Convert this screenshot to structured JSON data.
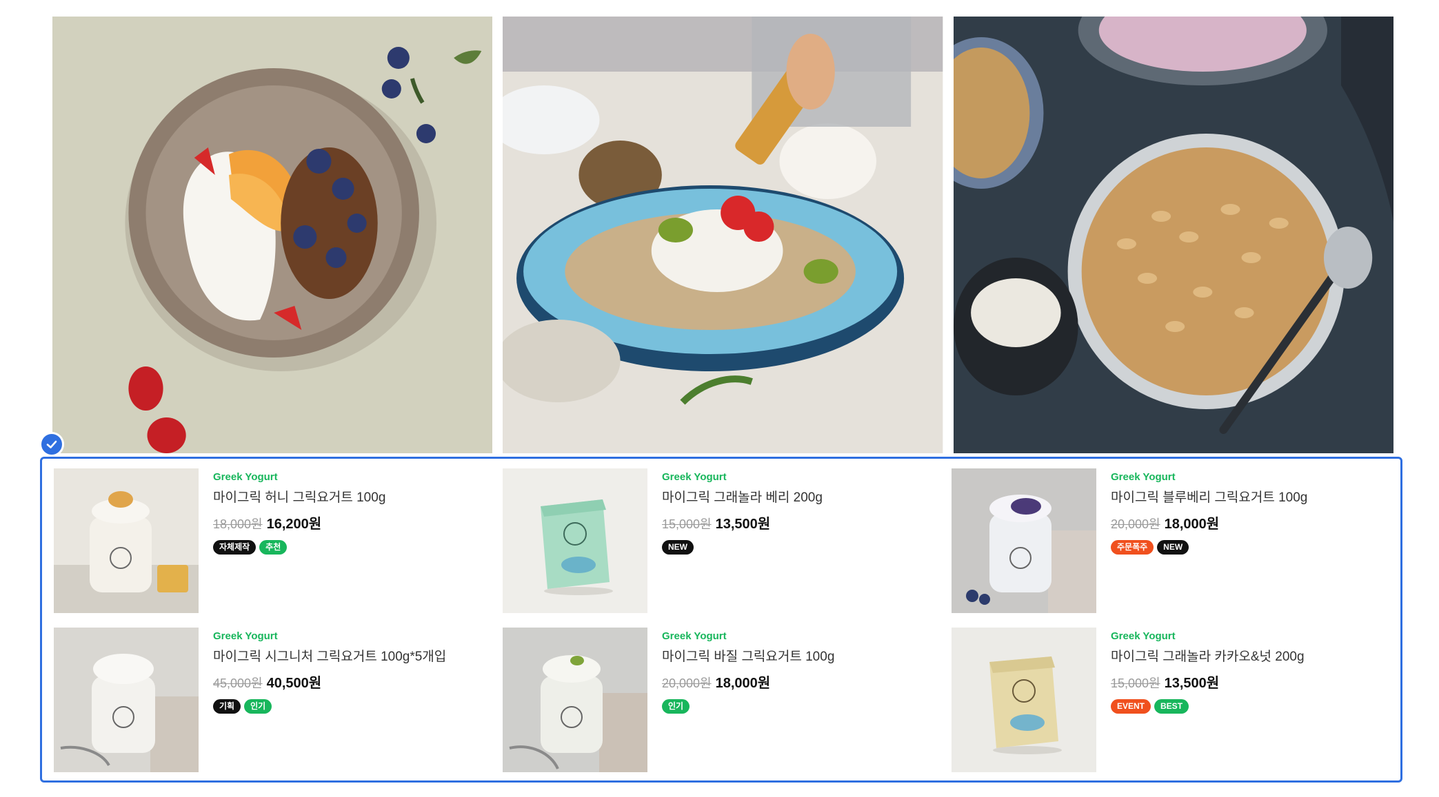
{
  "hero": {
    "photos": [
      {
        "icon": "yogurt-bowl-photo"
      },
      {
        "icon": "granola-honey-bowl-photo"
      },
      {
        "icon": "oat-granola-bowl-photo"
      }
    ]
  },
  "products": [
    {
      "category": "Greek Yogurt",
      "name": "마이그릭 허니 그릭요거트 100g",
      "old_price": "18,000원",
      "price": "16,200원",
      "badges": [
        {
          "label": "자체제작",
          "color": "black"
        },
        {
          "label": "추천",
          "color": "green"
        }
      ]
    },
    {
      "category": "Greek Yogurt",
      "name": "마이그릭 그래놀라 베리 200g",
      "old_price": "15,000원",
      "price": "13,500원",
      "badges": [
        {
          "label": "NEW",
          "color": "black"
        }
      ]
    },
    {
      "category": "Greek Yogurt",
      "name": "마이그릭 블루베리 그릭요거트 100g",
      "old_price": "20,000원",
      "price": "18,000원",
      "badges": [
        {
          "label": "주문폭주",
          "color": "orange"
        },
        {
          "label": "NEW",
          "color": "black"
        }
      ]
    },
    {
      "category": "Greek Yogurt",
      "name": "마이그릭 시그니처 그릭요거트 100g*5개입",
      "old_price": "45,000원",
      "price": "40,500원",
      "badges": [
        {
          "label": "기획",
          "color": "black"
        },
        {
          "label": "인기",
          "color": "green"
        }
      ]
    },
    {
      "category": "Greek Yogurt",
      "name": "마이그릭 바질 그릭요거트 100g",
      "old_price": "20,000원",
      "price": "18,000원",
      "badges": [
        {
          "label": "인기",
          "color": "green"
        }
      ]
    },
    {
      "category": "Greek Yogurt",
      "name": "마이그릭 그래놀라 카카오&넛 200g",
      "old_price": "15,000원",
      "price": "13,500원",
      "badges": [
        {
          "label": "EVENT",
          "color": "orange"
        },
        {
          "label": "BEST",
          "color": "green"
        }
      ]
    }
  ],
  "colors": {
    "accent": "#2f6fe0",
    "category": "#18b65c",
    "badge_black": "#111111",
    "badge_green": "#18b65c",
    "badge_orange": "#f0501e"
  },
  "selection": {
    "icon": "check-icon"
  }
}
